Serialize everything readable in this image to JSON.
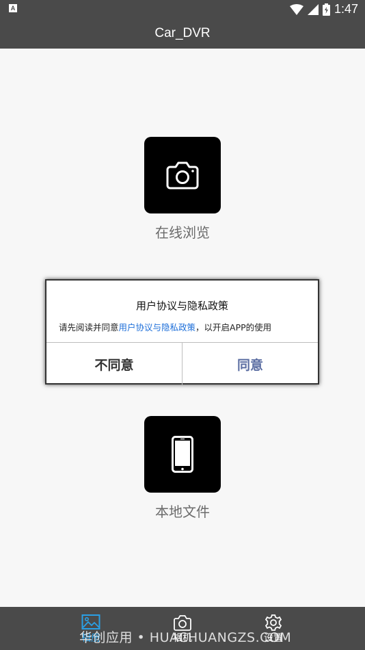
{
  "status_bar": {
    "time": "1:47",
    "left_icon_letter": "A"
  },
  "app": {
    "title": "Car_DVR"
  },
  "tiles": [
    {
      "label": "在线浏览",
      "icon": "camera-icon"
    },
    {
      "label": "本地文件",
      "icon": "phone-icon"
    }
  ],
  "dialog": {
    "title": "用户协议与隐私政策",
    "message_prefix": "请先阅读并同意",
    "message_link": "用户协议与隐私政策",
    "message_suffix": "，以开启APP的使用",
    "disagree_label": "不同意",
    "agree_label": "同意",
    "link_color": "#1e6fd9"
  },
  "bottom_nav": [
    {
      "label": "相册",
      "icon": "gallery-icon",
      "active": true
    },
    {
      "label": "相机",
      "icon": "camera-icon",
      "active": false
    },
    {
      "label": "设置",
      "icon": "gear-icon",
      "active": false
    }
  ],
  "watermark": "华创应用 • HUACHUANGZS.COM",
  "colors": {
    "bar": "#4a4a4a",
    "active": "#2aa0e6",
    "background": "#f7f7f7"
  }
}
